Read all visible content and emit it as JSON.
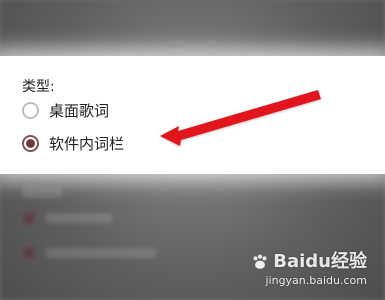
{
  "panel": {
    "type_label": "类型:",
    "options": [
      {
        "label": "桌面歌词",
        "selected": false
      },
      {
        "label": "软件内词栏",
        "selected": true
      }
    ]
  },
  "annotation": {
    "arrow_color": "#e0191d"
  },
  "watermark": {
    "brand": "Baidu经验",
    "url": "jingyan.baidu.com"
  },
  "colors": {
    "radio_checked": "#6c3b43",
    "radio_border_checked": "#8c4e56",
    "background_overlay": "#6e6e6e"
  },
  "icons": {
    "radio_unselected": "radio-empty-icon",
    "radio_selected": "radio-filled-icon",
    "arrow": "red-arrow-icon",
    "watermark_paw": "paw-icon"
  }
}
